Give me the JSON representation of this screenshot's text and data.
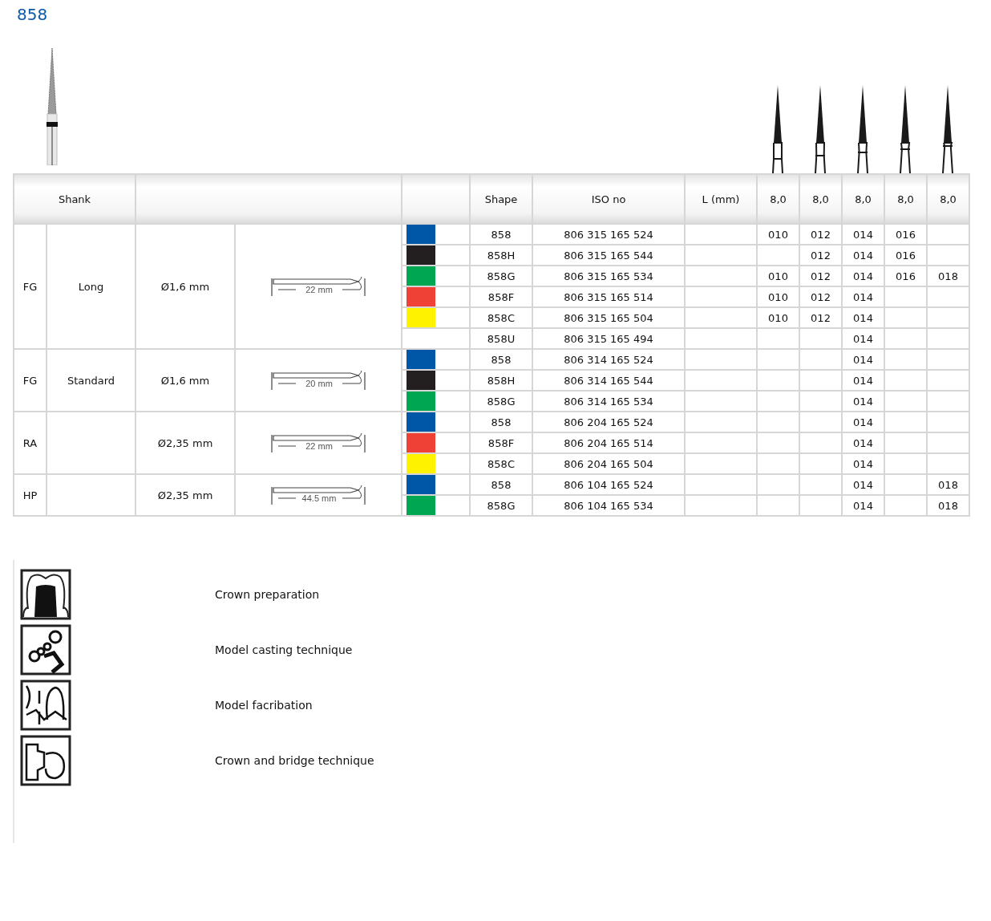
{
  "title": "858",
  "table": {
    "shank_header": "Shank",
    "columns": [
      "Shape",
      "ISO no",
      "L (mm)"
    ],
    "size_headers": [
      "8,0",
      "8,0",
      "8,0",
      "8,0",
      "8,0"
    ],
    "groups": [
      {
        "shank": "FG",
        "type": "Long",
        "diameter": "Ø1,6 mm",
        "length": "22 mm",
        "rows": [
          {
            "color": "#0057a8",
            "shape": "858",
            "iso": "806 315 165 524",
            "sizes": {
              "size_1": "010",
              "size_2": "012",
              "size_3": "014",
              "size_4": "016"
            }
          },
          {
            "color": "#231f20",
            "shape": "858H",
            "iso": "806 315 165 544",
            "sizes": {
              "size_2": "012",
              "size_3": "014",
              "size_4": "016"
            }
          },
          {
            "color": "#00a651",
            "shape": "858G",
            "iso": "806 315 165 534",
            "sizes": {
              "size_1": "010",
              "size_2": "012",
              "size_3": "014",
              "size_4": "016",
              "size_5": "018"
            }
          },
          {
            "color": "#ef4136",
            "shape": "858F",
            "iso": "806 315 165 514",
            "sizes": {
              "size_1": "010",
              "size_2": "012",
              "size_3": "014"
            }
          },
          {
            "color": "#fff200",
            "shape": "858C",
            "iso": "806 315 165 504",
            "sizes": {
              "size_1": "010",
              "size_2": "012",
              "size_3": "014"
            }
          },
          {
            "shape": "858U",
            "iso": "806 315 165 494",
            "sizes": {
              "size_3": "014"
            }
          }
        ]
      },
      {
        "shank": "FG",
        "type": "Standard",
        "diameter": "Ø1,6 mm",
        "length": "20 mm",
        "rows": [
          {
            "color": "#0057a8",
            "shape": "858",
            "iso": "806 314 165 524",
            "sizes": {
              "size_3": "014"
            }
          },
          {
            "color": "#231f20",
            "shape": "858H",
            "iso": "806 314 165 544",
            "sizes": {
              "size_3": "014"
            }
          },
          {
            "color": "#00a651",
            "shape": "858G",
            "iso": "806 314 165 534",
            "sizes": {
              "size_3": "014"
            }
          }
        ]
      },
      {
        "shank": "RA",
        "diameter": "Ø2,35 mm",
        "length": "22 mm",
        "rows": [
          {
            "color": "#0057a8",
            "shape": "858",
            "iso": "806 204 165 524",
            "sizes": {
              "size_3": "014"
            }
          },
          {
            "color": "#ef4136",
            "shape": "858F",
            "iso": "806 204 165 514",
            "sizes": {
              "size_3": "014"
            }
          },
          {
            "color": "#fff200",
            "shape": "858C",
            "iso": "806 204 165 504",
            "sizes": {
              "size_3": "014"
            }
          }
        ]
      },
      {
        "shank": "HP",
        "diameter": "Ø2,35 mm",
        "length": "44.5 mm",
        "rows": [
          {
            "color": "#0057a8",
            "shape": "858",
            "iso": "806 104 165 524",
            "sizes": {
              "size_3": "014",
              "size_5": "018"
            }
          },
          {
            "color": "#00a651",
            "shape": "858G",
            "iso": "806 104 165 534",
            "sizes": {
              "size_3": "014",
              "size_5": "018"
            }
          }
        ]
      }
    ]
  },
  "applications": [
    {
      "label": "Crown preparation"
    },
    {
      "label": "Model casting technique"
    },
    {
      "label": "Model facribation"
    },
    {
      "label": "Crown and bridge technique"
    }
  ]
}
